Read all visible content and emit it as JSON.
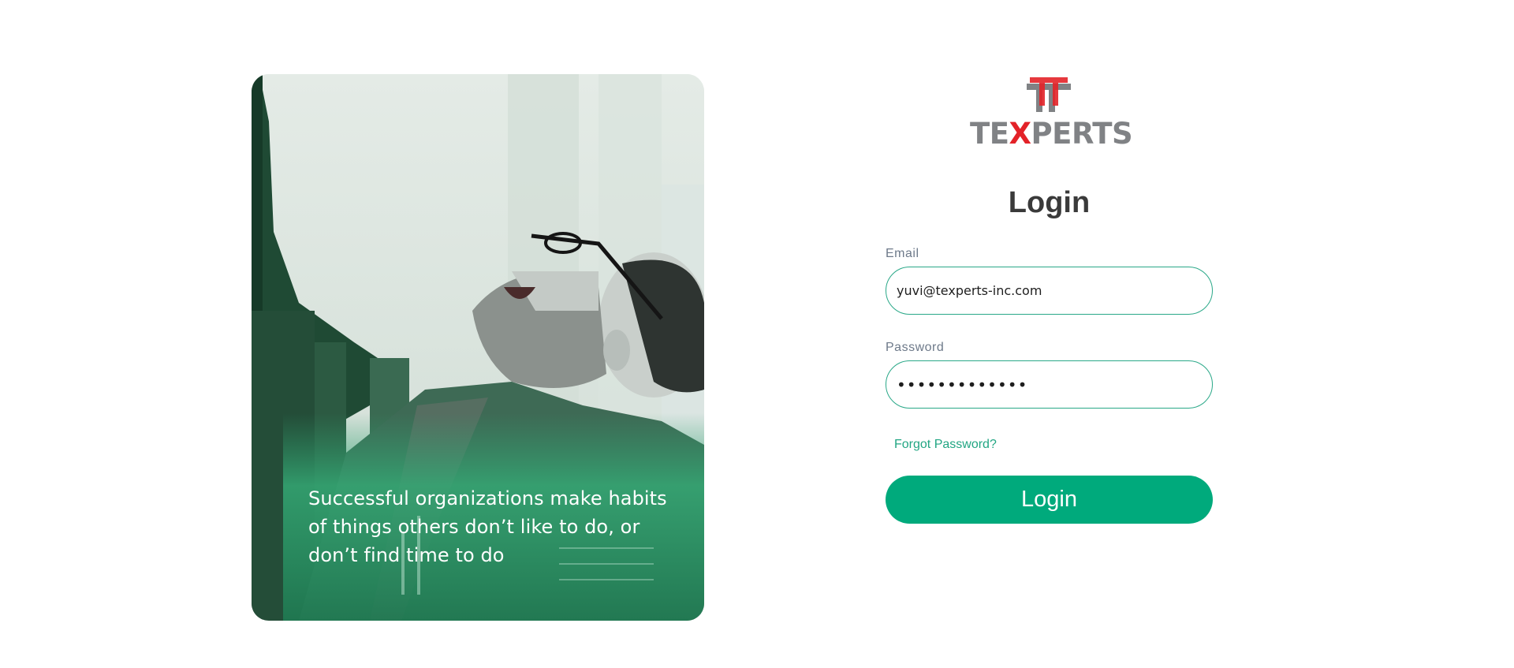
{
  "hero": {
    "quote": "Successful organizations make habits of things others  don’t like to do, or don’t find time to do"
  },
  "brand": {
    "logo_prefix": "TE",
    "logo_x": "X",
    "logo_suffix": "PERTS"
  },
  "form": {
    "title": "Login",
    "email_label": "Email",
    "email_value": "yuvi@texperts-inc.com",
    "password_label": "Password",
    "password_value": "•••••••••••••",
    "forgot_label": "Forgot Password?",
    "login_button": "Login"
  },
  "colors": {
    "accent": "#00aa7c",
    "field_border": "#2aa888",
    "logo_red": "#e32228",
    "logo_gray": "#808285"
  }
}
